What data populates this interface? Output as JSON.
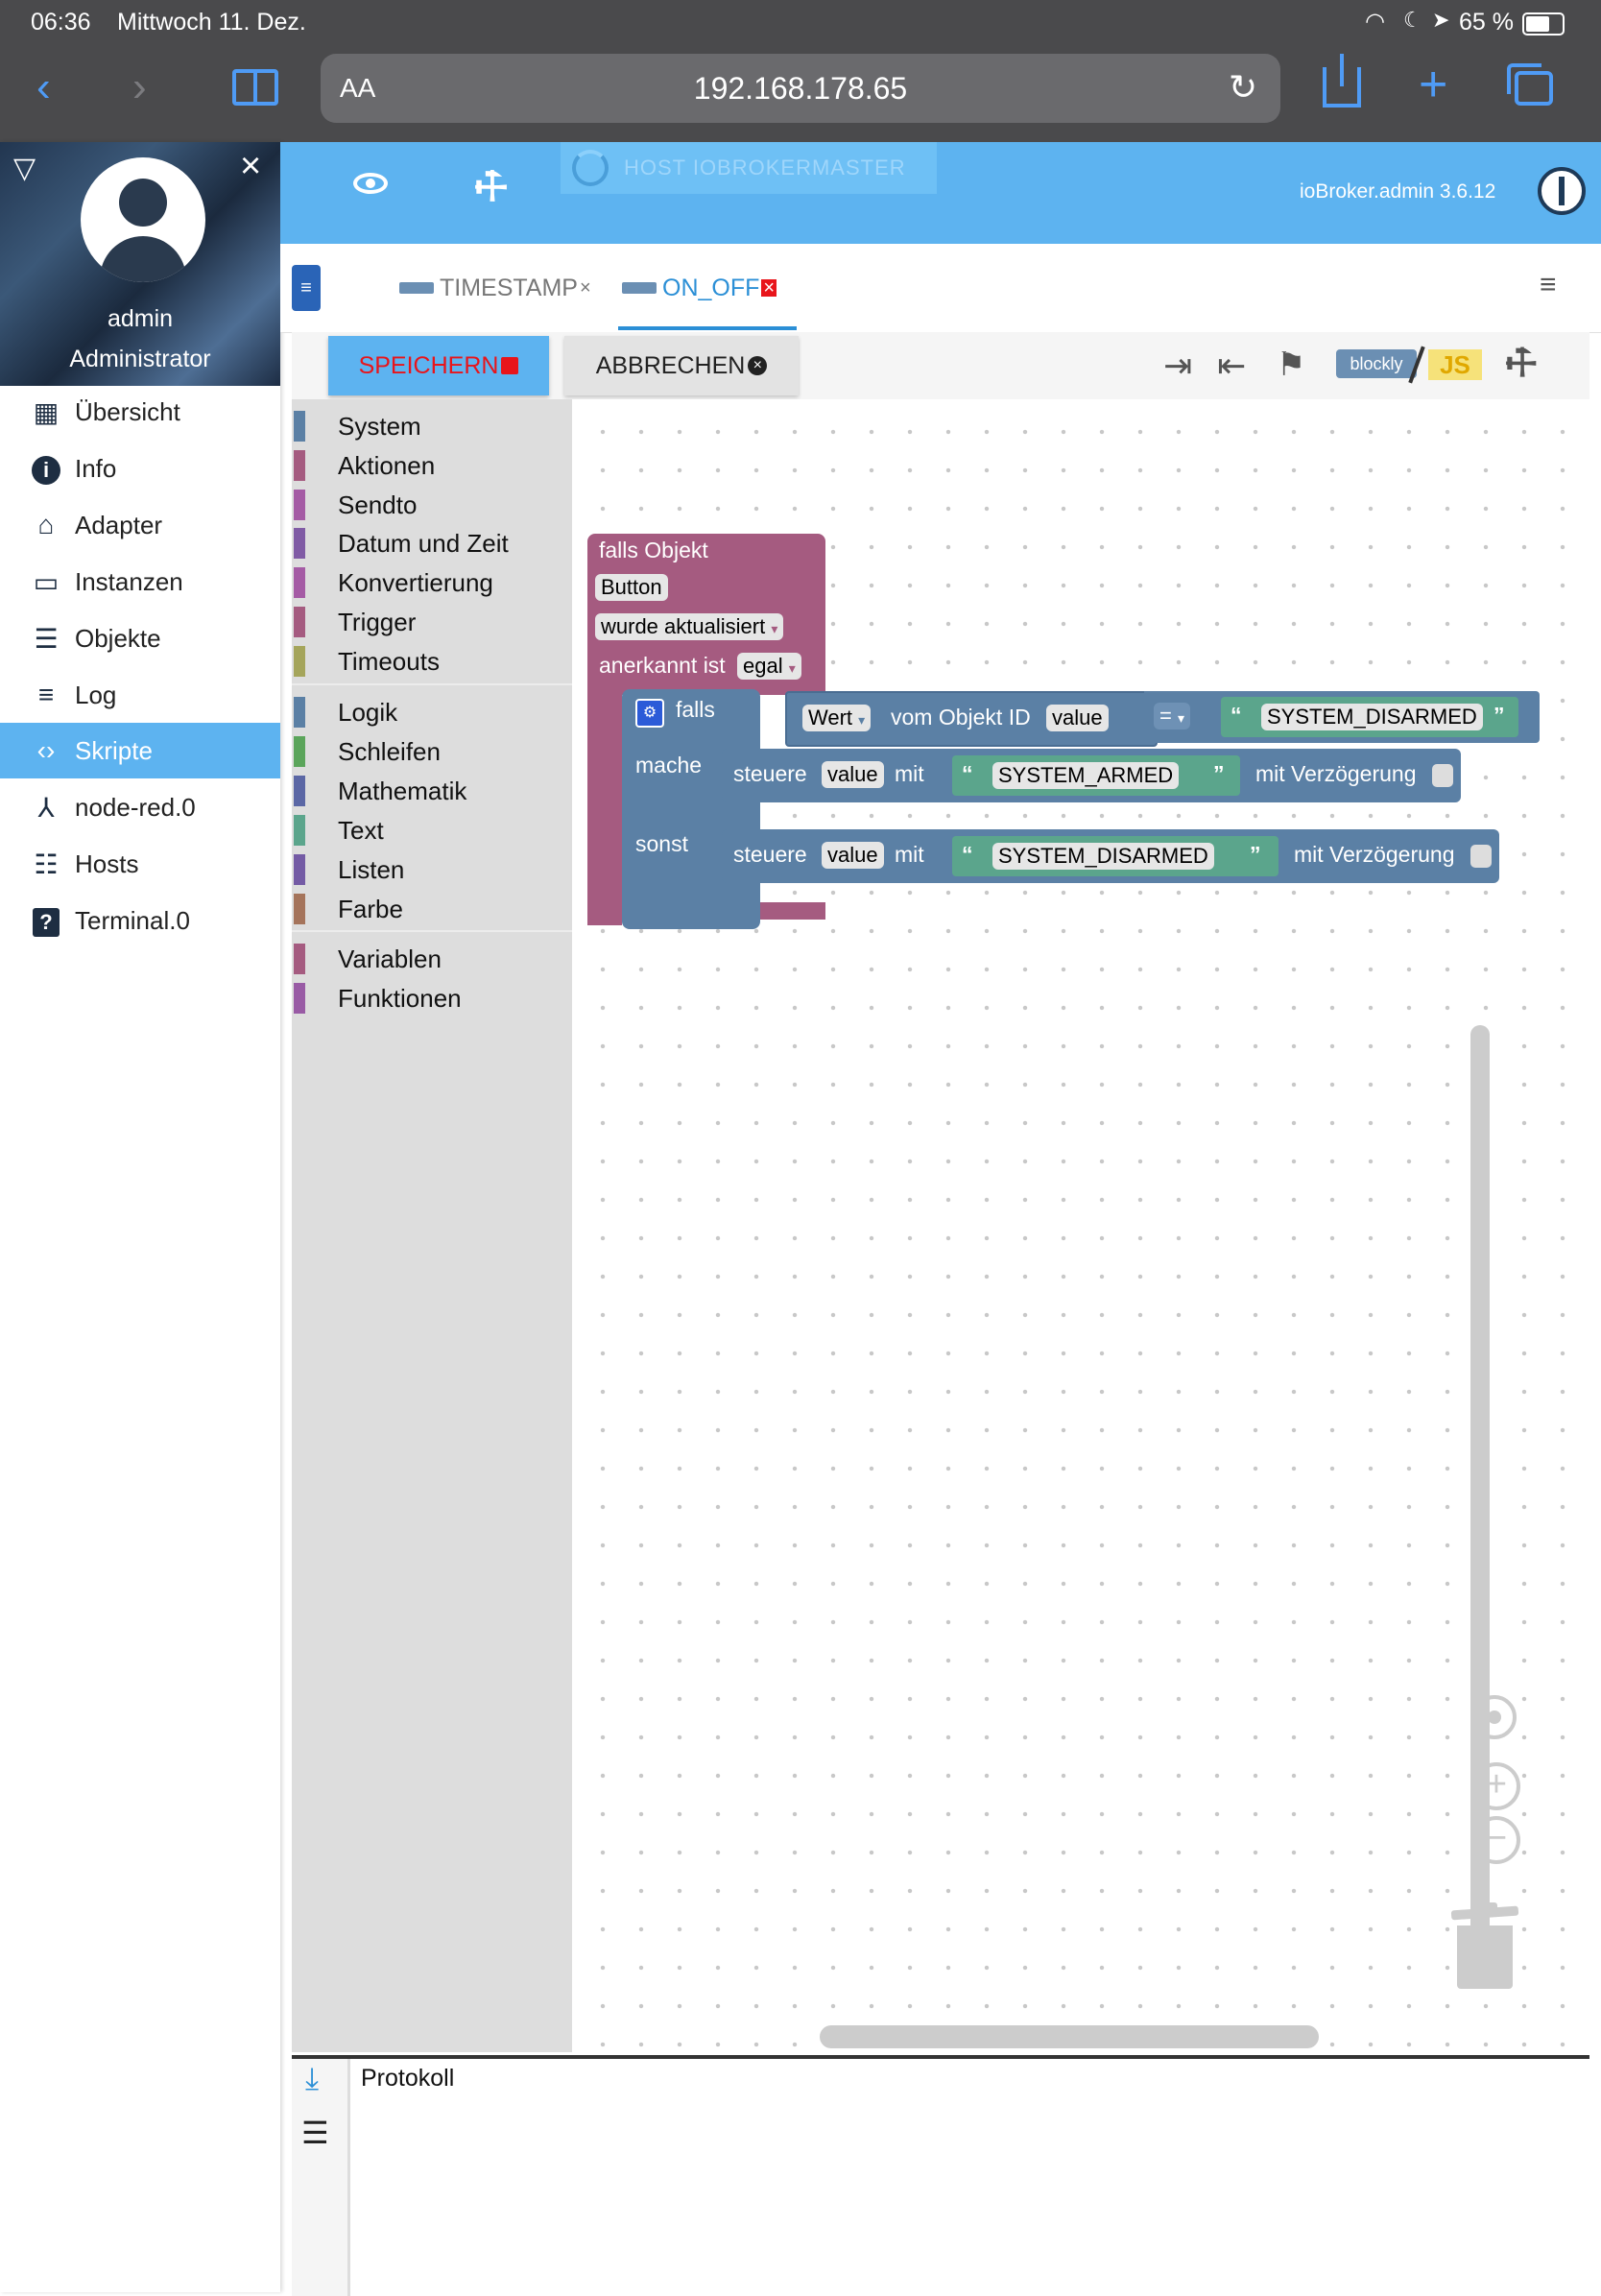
{
  "status": {
    "time": "06:36",
    "date": "Mittwoch 11. Dez.",
    "battery": "65 %"
  },
  "browser": {
    "text_size": "AA",
    "url": "192.168.178.65"
  },
  "sidebar": {
    "username": "admin",
    "role": "Administrator",
    "items": [
      {
        "label": "Übersicht",
        "icon": "grid-icon"
      },
      {
        "label": "Info",
        "icon": "info-icon"
      },
      {
        "label": "Adapter",
        "icon": "store-icon"
      },
      {
        "label": "Instanzen",
        "icon": "instances-icon"
      },
      {
        "label": "Objekte",
        "icon": "list-icon"
      },
      {
        "label": "Log",
        "icon": "log-icon"
      },
      {
        "label": "Skripte",
        "icon": "code-icon"
      },
      {
        "label": "node-red.0",
        "icon": "node-red-icon"
      },
      {
        "label": "Hosts",
        "icon": "hosts-icon"
      },
      {
        "label": "Terminal.0",
        "icon": "terminal-icon"
      }
    ],
    "active": "Skripte"
  },
  "appbar": {
    "host": "HOST IOBROKERMASTER",
    "version": "ioBroker.admin 3.6.12"
  },
  "tabs": [
    {
      "label": "TIMESTAMP",
      "close": "×"
    },
    {
      "label": "ON_OFF",
      "close": "×"
    }
  ],
  "toolbar": {
    "save": "SPEICHERN",
    "cancel": "ABBRECHEN",
    "blockly": "blockly",
    "js": "JS"
  },
  "toolbox": {
    "group1": [
      {
        "label": "System",
        "color": "#5b80a5"
      },
      {
        "label": "Aktionen",
        "color": "#a55b80"
      },
      {
        "label": "Sendto",
        "color": "#a55ba5"
      },
      {
        "label": "Datum und Zeit",
        "color": "#805ba5"
      },
      {
        "label": "Konvertierung",
        "color": "#a55ba5"
      },
      {
        "label": "Trigger",
        "color": "#a55b80"
      },
      {
        "label": "Timeouts",
        "color": "#a5a55b"
      }
    ],
    "group2": [
      {
        "label": "Logik",
        "color": "#5b80a5"
      },
      {
        "label": "Schleifen",
        "color": "#5ba55b"
      },
      {
        "label": "Mathematik",
        "color": "#5b67a5"
      },
      {
        "label": "Text",
        "color": "#5ba58c"
      },
      {
        "label": "Listen",
        "color": "#745ba5"
      },
      {
        "label": "Farbe",
        "color": "#a5745b"
      }
    ],
    "group3": [
      {
        "label": "Variablen",
        "color": "#a55b80"
      },
      {
        "label": "Funktionen",
        "color": "#995ba5"
      }
    ]
  },
  "blocks": {
    "trigger": {
      "title": "falls Objekt",
      "object": "Button",
      "event": "wurde aktualisiert",
      "ack_label": "anerkannt ist",
      "ack_value": "egal"
    },
    "if_block": {
      "if_label": "falls",
      "do_label": "mache",
      "else_label": "sonst",
      "compare": {
        "value_label": "Wert",
        "from_label": "vom Objekt ID",
        "object_id": "value",
        "operator": "=",
        "string": "SYSTEM_DISARMED"
      },
      "do_action": {
        "verb": "steuere",
        "object_id": "value",
        "with_label": "mit",
        "string": "SYSTEM_ARMED",
        "delay_label": "mit Verzögerung"
      },
      "else_action": {
        "verb": "steuere",
        "object_id": "value",
        "with_label": "mit",
        "string": "SYSTEM_DISARMED",
        "delay_label": "mit Verzögerung"
      }
    }
  },
  "log": {
    "title": "Protokoll"
  },
  "colors": {
    "accent": "#5db3f0",
    "save_text": "#e8151b",
    "trigger_block": "#a55b80",
    "logic_block": "#5b80a5",
    "text_block": "#5ba58c"
  }
}
